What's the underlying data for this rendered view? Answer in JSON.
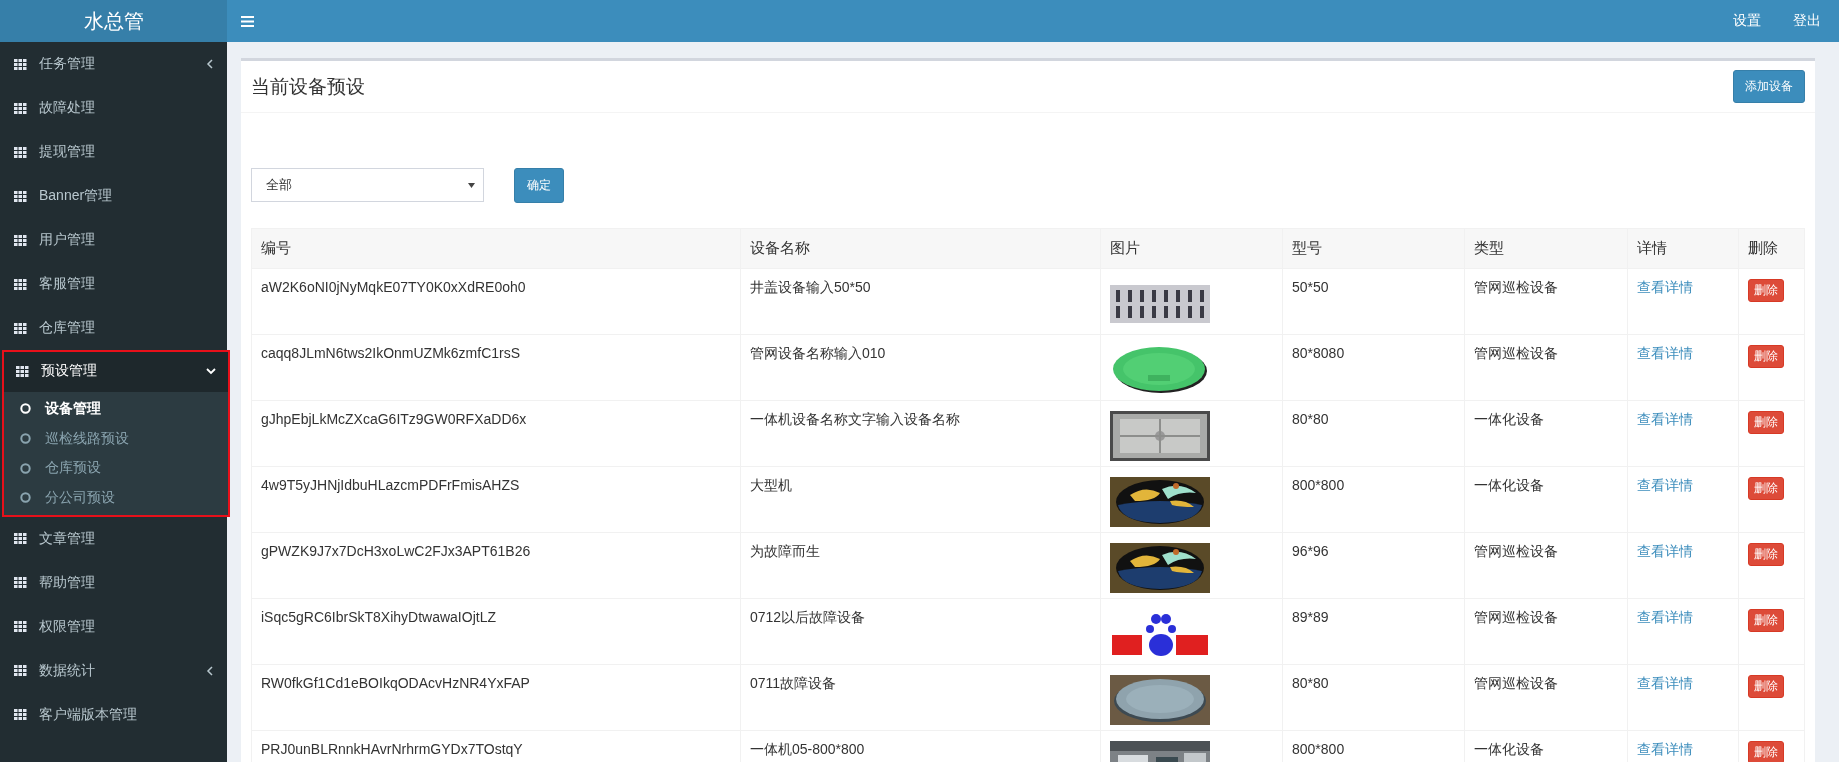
{
  "sidebar": {
    "logo": "水总管",
    "items": [
      {
        "label": "任务管理",
        "expanded": false
      },
      {
        "label": "故障处理"
      },
      {
        "label": "提现管理"
      },
      {
        "label": "Banner管理"
      },
      {
        "label": "用户管理"
      },
      {
        "label": "客服管理"
      },
      {
        "label": "仓库管理"
      },
      {
        "label": "预设管理",
        "expanded": true,
        "highlighted": true,
        "children": [
          {
            "label": "设备管理",
            "selected": true
          },
          {
            "label": "巡检线路预设",
            "selected": false
          },
          {
            "label": "仓库预设",
            "selected": false
          },
          {
            "label": "分公司预设",
            "selected": false
          }
        ]
      },
      {
        "label": "文章管理"
      },
      {
        "label": "帮助管理"
      },
      {
        "label": "权限管理"
      },
      {
        "label": "数据统计",
        "expanded": false
      },
      {
        "label": "客户端版本管理"
      }
    ]
  },
  "topbar": {
    "links": [
      "设置",
      "登出"
    ]
  },
  "card": {
    "title": "当前设备预设",
    "add_button": "添加设备",
    "filter": {
      "value": "全部"
    },
    "confirm_button": "确定"
  },
  "table": {
    "columns": [
      "编号",
      "设备名称",
      "图片",
      "型号",
      "类型",
      "详情",
      "删除"
    ],
    "rows": [
      {
        "id": "aW2K6oNI0jNyMqkE07TY0K0xXdRE0oh0",
        "name": "井盖设备输入50*50",
        "model": "50*50",
        "type": "管网巡检设备",
        "detail": "查看详情",
        "delete": "删除"
      },
      {
        "id": "caqq8JLmN6tws2IkOnmUZMk6zmfC1rsS",
        "name": "管网设备名称输入010",
        "model": "80*8080",
        "type": "管网巡检设备",
        "detail": "查看详情",
        "delete": "删除"
      },
      {
        "id": "gJhpEbjLkMcZXcaG6ITz9GW0RFXaDD6x",
        "name": "一体机设备名称文字输入设备名称",
        "model": "80*80",
        "type": "一体化设备",
        "detail": "查看详情",
        "delete": "删除"
      },
      {
        "id": "4w9T5yJHNjIdbuHLazcmPDFrFmisAHZS",
        "name": "大型机",
        "model": "800*800",
        "type": "一体化设备",
        "detail": "查看详情",
        "delete": "删除"
      },
      {
        "id": "gPWZK9J7x7DcH3xoLwC2FJx3APT61B26",
        "name": "为故障而生",
        "model": "96*96",
        "type": "管网巡检设备",
        "detail": "查看详情",
        "delete": "删除"
      },
      {
        "id": "iSqc5gRC6IbrSkT8XihyDtwawaIOjtLZ",
        "name": "0712以后故障设备",
        "model": "89*89",
        "type": "管网巡检设备",
        "detail": "查看详情",
        "delete": "删除"
      },
      {
        "id": "RW0fkGf1Cd1eBOIkqODAcvHzNR4YxFAP",
        "name": "0711故障设备",
        "model": "80*80",
        "type": "管网巡检设备",
        "detail": "查看详情",
        "delete": "删除"
      },
      {
        "id": "PRJ0unBLRnnkHAvrNrhrmGYDx7TOstqY",
        "name": "一体机05-800*800",
        "model": "800*800",
        "type": "一体化设备",
        "detail": "查看详情",
        "delete": "删除"
      }
    ]
  }
}
